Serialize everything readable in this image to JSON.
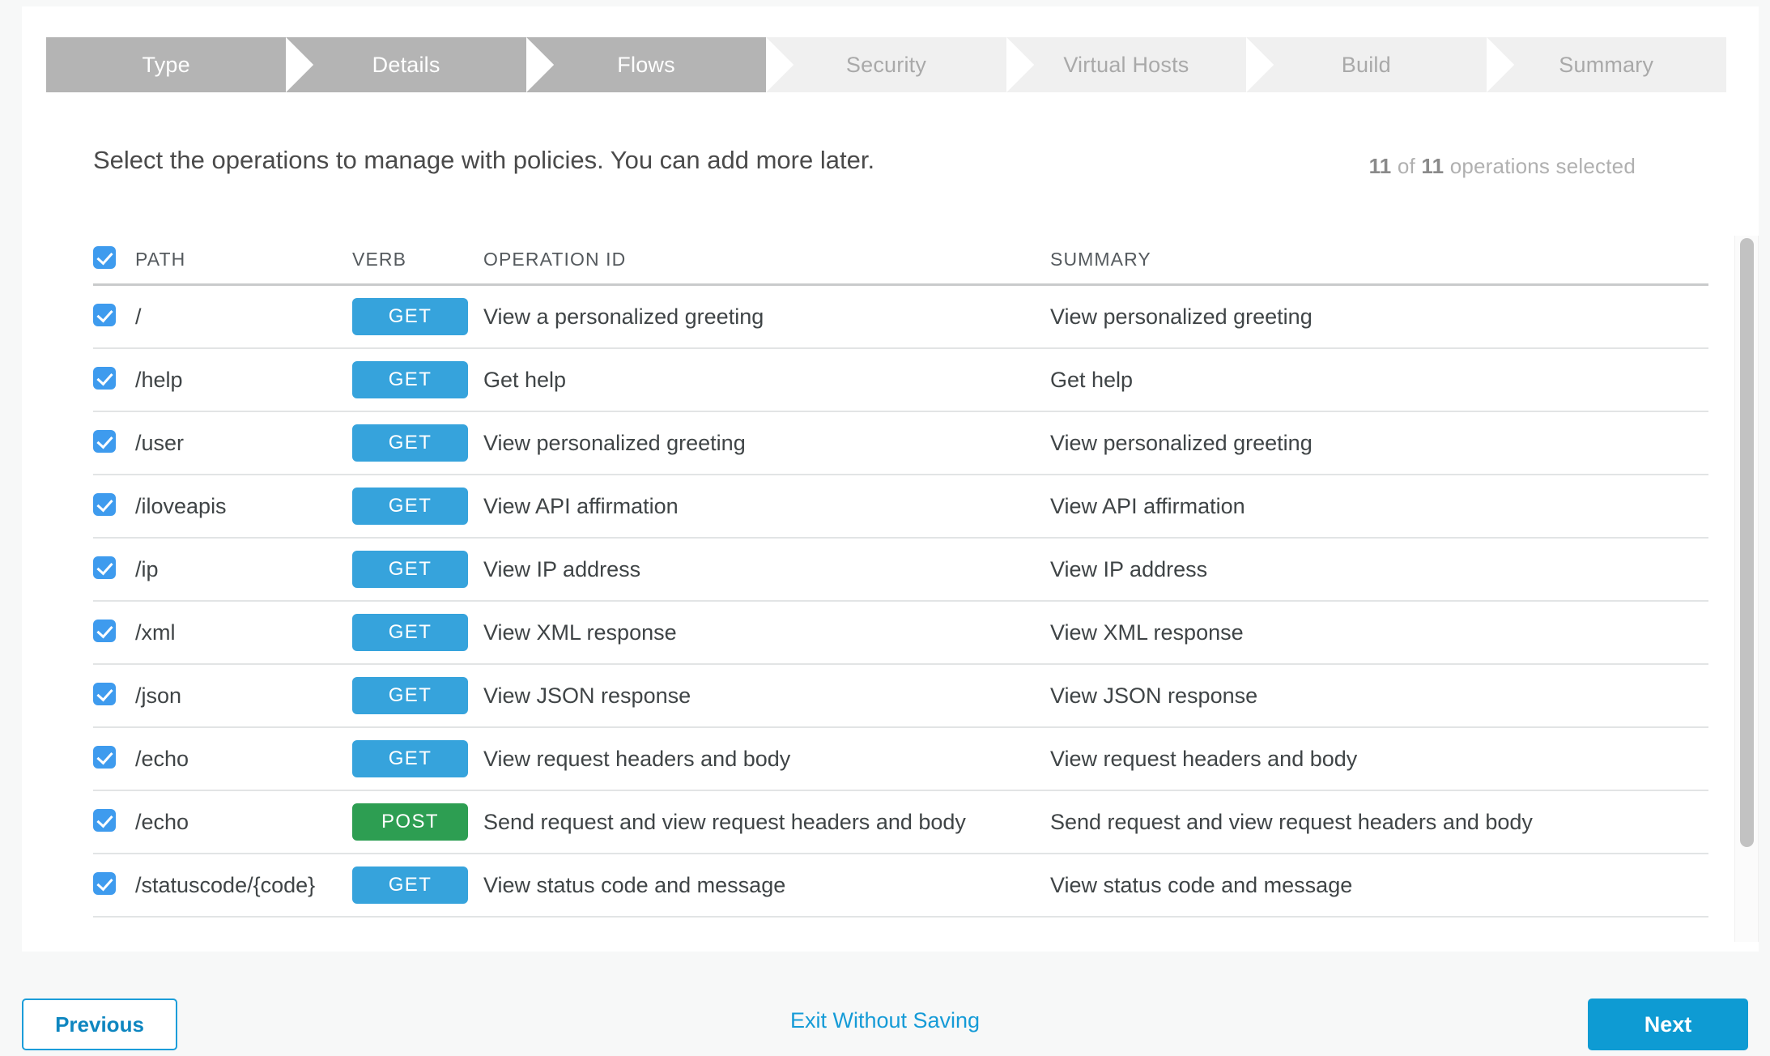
{
  "wizard": {
    "steps": [
      {
        "label": "Type",
        "state": "done"
      },
      {
        "label": "Details",
        "state": "done"
      },
      {
        "label": "Flows",
        "state": "done"
      },
      {
        "label": "Security",
        "state": "todo"
      },
      {
        "label": "Virtual Hosts",
        "state": "todo"
      },
      {
        "label": "Build",
        "state": "todo"
      },
      {
        "label": "Summary",
        "state": "todo"
      }
    ]
  },
  "main": {
    "instruction": "Select the operations to manage with policies. You can add more later.",
    "counter": {
      "selected": "11",
      "middle": " of ",
      "total": "11",
      "suffix": " operations selected"
    },
    "table": {
      "headers": {
        "path": "PATH",
        "verb": "VERB",
        "operation_id": "OPERATION ID",
        "summary": "SUMMARY"
      },
      "select_all_checked": true,
      "rows": [
        {
          "checked": true,
          "path": "/",
          "verb": "GET",
          "operation_id": "View a personalized greeting",
          "summary": "View personalized greeting"
        },
        {
          "checked": true,
          "path": "/help",
          "verb": "GET",
          "operation_id": "Get help",
          "summary": "Get help"
        },
        {
          "checked": true,
          "path": "/user",
          "verb": "GET",
          "operation_id": "View personalized greeting",
          "summary": "View personalized greeting"
        },
        {
          "checked": true,
          "path": "/iloveapis",
          "verb": "GET",
          "operation_id": "View API affirmation",
          "summary": "View API affirmation"
        },
        {
          "checked": true,
          "path": "/ip",
          "verb": "GET",
          "operation_id": "View IP address",
          "summary": "View IP address"
        },
        {
          "checked": true,
          "path": "/xml",
          "verb": "GET",
          "operation_id": "View XML response",
          "summary": "View XML response"
        },
        {
          "checked": true,
          "path": "/json",
          "verb": "GET",
          "operation_id": "View JSON response",
          "summary": "View JSON response"
        },
        {
          "checked": true,
          "path": "/echo",
          "verb": "GET",
          "operation_id": "View request headers and body",
          "summary": "View request headers and body"
        },
        {
          "checked": true,
          "path": "/echo",
          "verb": "POST",
          "operation_id": "Send request and view request headers and body",
          "summary": "Send request and view request headers and body"
        },
        {
          "checked": true,
          "path": "/statuscode/{code}",
          "verb": "GET",
          "operation_id": "View status code and message",
          "summary": "View status code and message"
        }
      ]
    }
  },
  "footer": {
    "previous_label": "Previous",
    "exit_label": "Exit Without Saving",
    "next_label": "Next"
  },
  "colors": {
    "get_badge": "#36a3dc",
    "post_badge": "#2d9e52",
    "checkbox": "#3e9bee",
    "primary_action": "#0e9bd3",
    "link": "#159bd7",
    "step_done": "#b4b4b4",
    "step_todo": "#f0f0f0"
  }
}
